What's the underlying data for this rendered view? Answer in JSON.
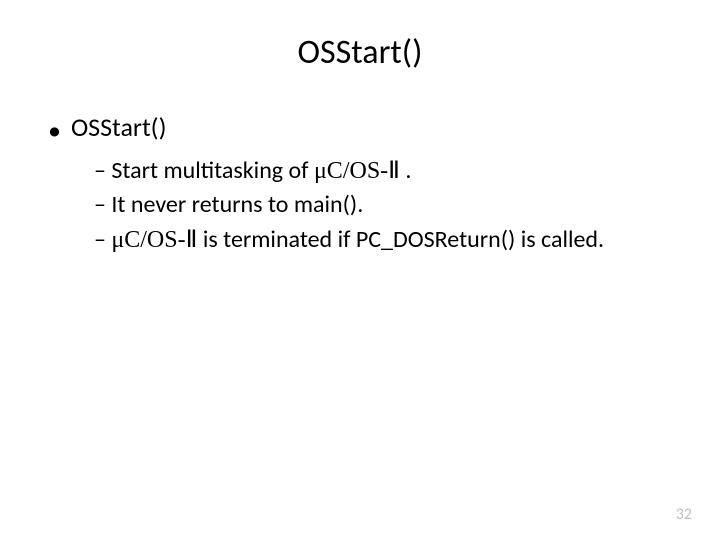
{
  "title": "OSStart()",
  "bullet_label": "OSStart()",
  "items": [
    {
      "prefix": "– Start multitasking of ",
      "serif": "μC/OS-Ⅱ",
      "suffix": " ."
    },
    {
      "prefix": "– It never returns to main().",
      "serif": "",
      "suffix": ""
    },
    {
      "prefix": "– ",
      "serif": "μC/OS-Ⅱ",
      "suffix": " is terminated if PC_DOSReturn() is called."
    }
  ],
  "page_number": "32"
}
